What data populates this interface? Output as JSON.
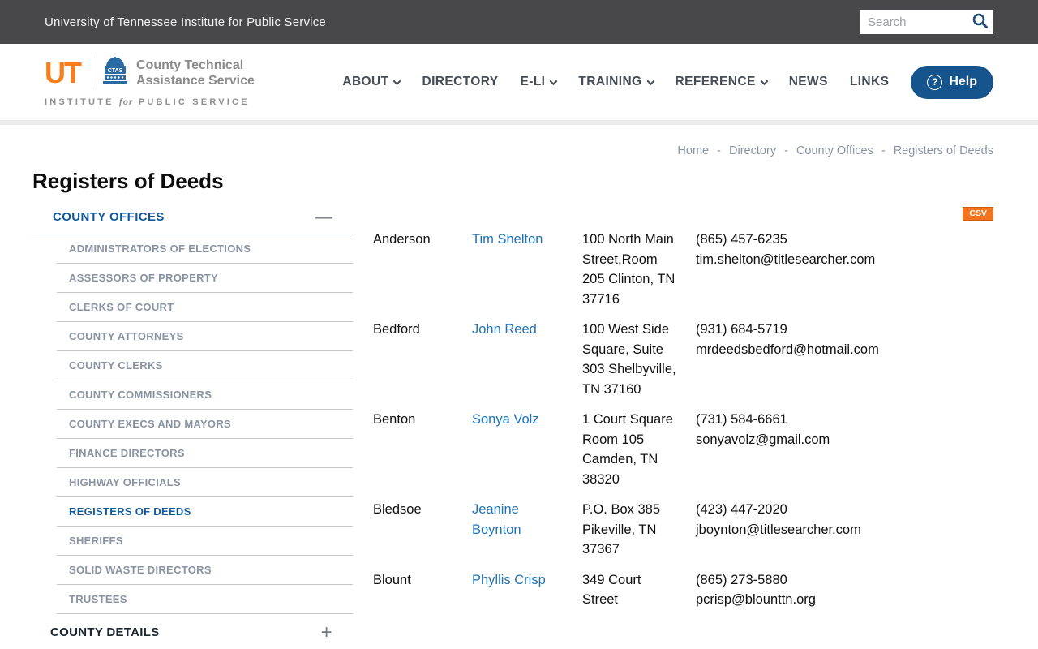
{
  "topbar": {
    "title": "University of Tennessee Institute for Public Service",
    "search_placeholder": "Search"
  },
  "header": {
    "logo": {
      "ut": "UT",
      "ctas": "CTAS",
      "org_line1": "County Technical",
      "org_line2": "Assistance Service",
      "institute_pre": "INSTITUTE",
      "institute_mid": "for",
      "institute_post": "PUBLIC SERVICE"
    },
    "nav": [
      {
        "label": "ABOUT",
        "has_dropdown": true
      },
      {
        "label": "DIRECTORY",
        "has_dropdown": false
      },
      {
        "label": "E-LI",
        "has_dropdown": true
      },
      {
        "label": "TRAINING",
        "has_dropdown": true
      },
      {
        "label": "REFERENCE",
        "has_dropdown": true
      },
      {
        "label": "NEWS",
        "has_dropdown": false
      },
      {
        "label": "LINKS",
        "has_dropdown": false
      }
    ],
    "help_label": "Help",
    "help_icon": "?"
  },
  "breadcrumb": {
    "items": [
      "Home",
      "Directory",
      "County Offices",
      "Registers of Deeds"
    ],
    "separator": "-"
  },
  "page": {
    "title": "Registers of Deeds"
  },
  "sidebar": {
    "section_title": "COUNTY OFFICES",
    "collapse_icon": "—",
    "items": [
      "ADMINISTRATORS OF ELECTIONS",
      "ASSESSORS OF PROPERTY",
      "CLERKS OF COURT",
      "COUNTY ATTORNEYS",
      "COUNTY CLERKS",
      "COUNTY COMMISSIONERS",
      "COUNTY EXECS AND MAYORS",
      "FINANCE DIRECTORS",
      "HIGHWAY OFFICIALS",
      "REGISTERS OF DEEDS",
      "SHERIFFS",
      "SOLID WASTE DIRECTORS",
      "TRUSTEES"
    ],
    "active_item": "REGISTERS OF DEEDS",
    "details_title": "COUNTY DETAILS",
    "expand_icon": "+"
  },
  "table": {
    "csv_label": "CSV",
    "rows": [
      {
        "county": "Anderson",
        "name": "Tim Shelton",
        "address1": "100 North Main Street,Room 205",
        "address2": "Clinton, TN 37716",
        "phone": "(865) 457-6235",
        "email": "tim.shelton@titlesearcher.com"
      },
      {
        "county": "Bedford",
        "name": "John Reed",
        "address1": "100 West Side Square, Suite 303",
        "address2": "Shelbyville, TN 37160",
        "phone": "(931) 684-5719",
        "email": "mrdeedsbedford@hotmail.com"
      },
      {
        "county": "Benton",
        "name": "Sonya Volz",
        "address1": "1 Court Square Room 105",
        "address2": "Camden, TN 38320",
        "phone": "(731) 584-6661",
        "email": "sonyavolz@gmail.com"
      },
      {
        "county": "Bledsoe",
        "name": "Jeanine Boynton",
        "address1": "P.O. Box 385",
        "address2": "Pikeville, TN 37367",
        "phone": "(423) 447-2020",
        "email": "jboynton@titlesearcher.com"
      },
      {
        "county": "Blount",
        "name": "Phyllis Crisp",
        "address1": "349 Court Street",
        "address2": "",
        "phone": "(865) 273-5880",
        "email": "pcrisp@blounttn.org"
      }
    ]
  },
  "colors": {
    "topbar_bg": "#48484a",
    "accent_blue": "#15548c",
    "link_blue": "#1d72b8",
    "sidebar_active_blue": "#0f5a9e",
    "sidebar_gray": "#8a93a3",
    "csv_orange": "#f4731f",
    "ut_orange": "#f77e1b"
  }
}
